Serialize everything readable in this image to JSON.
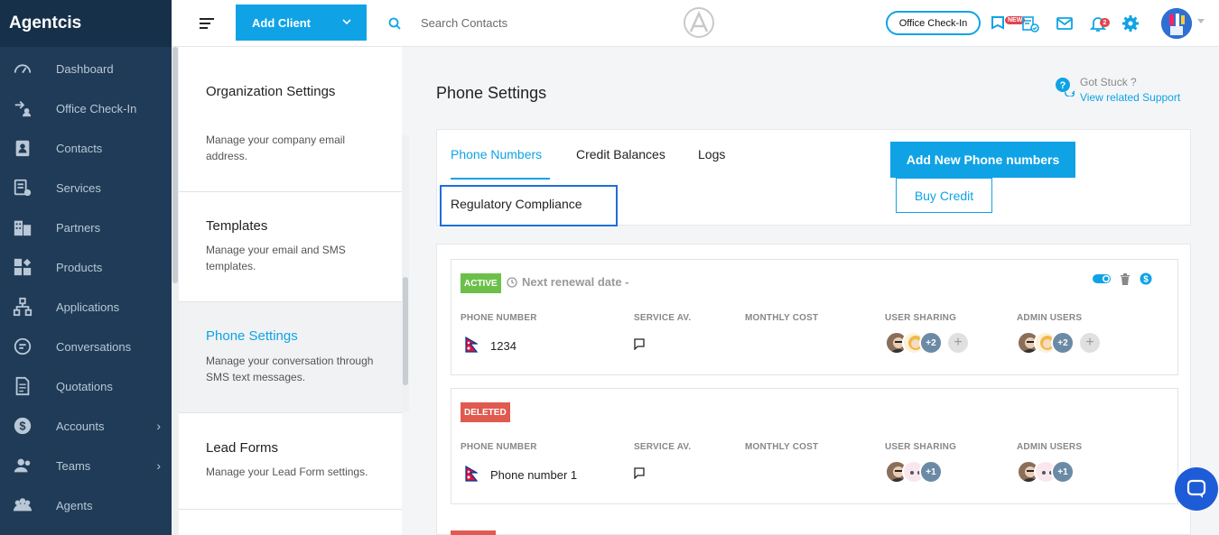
{
  "brand": "Agentcis",
  "sidebar": {
    "items": [
      {
        "label": "Dashboard",
        "icon": "gauge-icon"
      },
      {
        "label": "Office Check-In",
        "icon": "checkin-icon"
      },
      {
        "label": "Contacts",
        "icon": "contacts-icon"
      },
      {
        "label": "Services",
        "icon": "services-icon"
      },
      {
        "label": "Partners",
        "icon": "partners-icon"
      },
      {
        "label": "Products",
        "icon": "products-icon"
      },
      {
        "label": "Applications",
        "icon": "applications-icon"
      },
      {
        "label": "Conversations",
        "icon": "conversations-icon"
      },
      {
        "label": "Quotations",
        "icon": "quotations-icon"
      },
      {
        "label": "Accounts",
        "icon": "accounts-icon",
        "has_children": true
      },
      {
        "label": "Teams",
        "icon": "teams-icon",
        "has_children": true
      },
      {
        "label": "Agents",
        "icon": "agents-icon"
      }
    ]
  },
  "topbar": {
    "add_client_label": "Add Client",
    "search_placeholder": "Search Contacts",
    "office_checkin_label": "Office Check-In",
    "new_badge": "NEW",
    "notification_count": "2"
  },
  "settings_list": [
    {
      "title": "Organization Settings",
      "desc": "Manage your company email address."
    },
    {
      "title": "Templates",
      "desc": "Manage your email and SMS templates."
    },
    {
      "title": "Phone Settings",
      "desc": "Manage your conversation through SMS text messages.",
      "active": true
    },
    {
      "title": "Lead Forms",
      "desc": "Manage your Lead Form settings."
    }
  ],
  "main": {
    "title": "Phone Settings",
    "help_question": "Got Stuck ?",
    "help_link": "View related Support",
    "tabs": [
      "Phone Numbers",
      "Credit Balances",
      "Logs",
      "Regulatory Compliance"
    ],
    "active_tab": "Phone Numbers",
    "add_phone_label": "Add New Phone numbers",
    "buy_credit_label": "Buy Credit"
  },
  "columns": {
    "phone_number": "PHONE NUMBER",
    "service": "SERVICE AV.",
    "monthly_cost": "MONTHLY COST",
    "user_sharing": "USER SHARING",
    "admin_users": "ADMIN USERS"
  },
  "phone_cards": [
    {
      "status": "ACTIVE",
      "renewal": "Next renewal date -",
      "phone": "1234",
      "user_more": "+2",
      "admin_more": "+2"
    },
    {
      "status": "DELETED",
      "renewal": "",
      "phone": "Phone number 1",
      "user_more": "+1",
      "admin_more": "+1"
    }
  ],
  "colors": {
    "accent": "#0fa3e6",
    "sidebar": "#1f3b57",
    "active_badge": "#6cc04a",
    "deleted_badge": "#e05a4f"
  }
}
